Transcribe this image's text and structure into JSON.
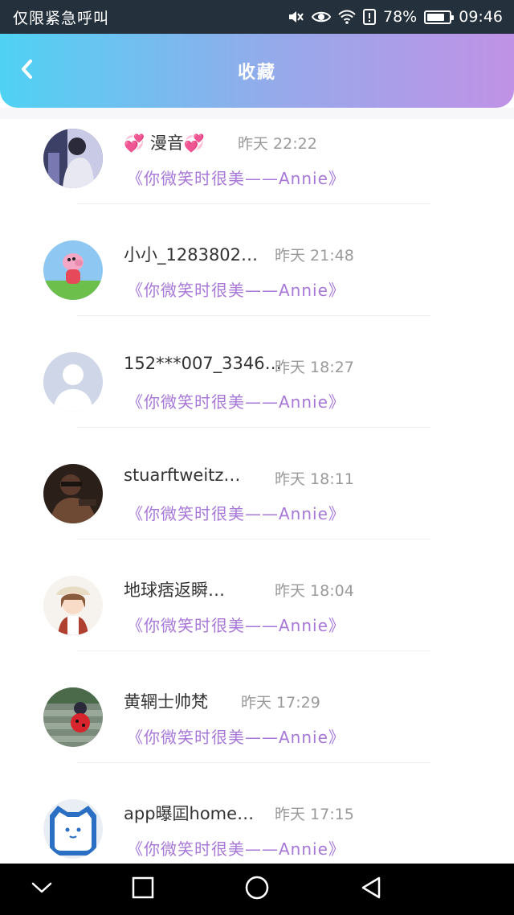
{
  "status_bar": {
    "carrier_text": "仅限紧急呼叫",
    "battery_percent": "78%",
    "battery_level": 0.78,
    "time": "09:46",
    "icons": [
      "mute-icon",
      "eye-icon",
      "wifi-icon",
      "alert-icon",
      "battery-icon"
    ]
  },
  "header": {
    "back_icon": "chevron-left-icon",
    "title": "收藏"
  },
  "favorites": [
    {
      "name": "💞 漫音💞",
      "time": "昨天 22:22",
      "quote": "《你微笑时很美——Annie》"
    },
    {
      "name": "小小_1283802…",
      "time": "昨天 21:48",
      "quote": "《你微笑时很美——Annie》"
    },
    {
      "name": "152***007_3346…",
      "time": "昨天 18:27",
      "quote": "《你微笑时很美——Annie》"
    },
    {
      "name": "stuarftweitz…",
      "time": "昨天 18:11",
      "quote": "《你微笑时很美——Annie》"
    },
    {
      "name": "地球痞返瞬…",
      "time": "昨天 18:04",
      "quote": "《你微笑时很美——Annie》"
    },
    {
      "name": "黄辋士帅梵",
      "time": "昨天 17:29",
      "quote": "《你微笑时很美——Annie》"
    },
    {
      "name": "app曝囸home…",
      "time": "昨天 17:15",
      "quote": "《你微笑时很美——Annie》"
    }
  ],
  "nav_bar": {
    "icons": [
      "chevron-down-icon",
      "square-icon",
      "circle-icon",
      "triangle-back-icon"
    ]
  },
  "colors": {
    "status_bar_bg": "#24313c",
    "header_gradient_start": "#4fd2f4",
    "header_gradient_end": "#c092e6",
    "quote_color": "#a878d8",
    "time_color": "#9a9a9a"
  }
}
